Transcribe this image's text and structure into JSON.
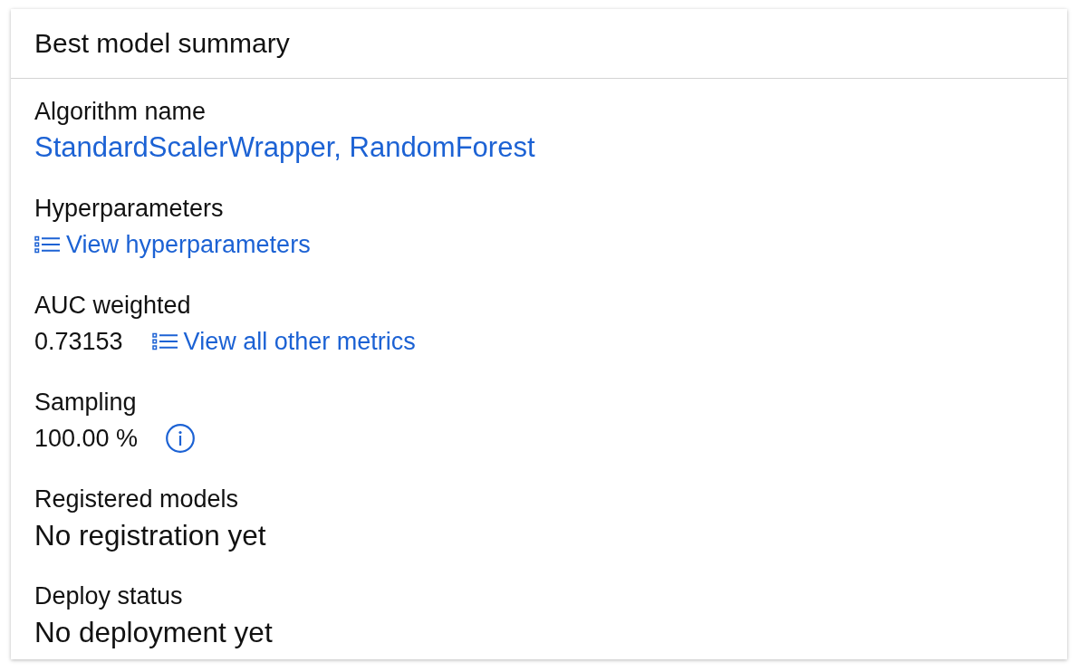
{
  "card": {
    "title": "Best model summary"
  },
  "fields": [
    {
      "kind": "link",
      "label": "Algorithm name",
      "link": "StandardScalerWrapper, RandomForest"
    },
    {
      "kind": "list_link",
      "label": "Hyperparameters",
      "link": "View hyperparameters"
    },
    {
      "kind": "value_list_link",
      "label": "AUC weighted",
      "value": "0.73153",
      "link": "View all other metrics"
    },
    {
      "kind": "value_info",
      "label": "Sampling",
      "value": "100.00 %"
    },
    {
      "kind": "text",
      "label": "Registered models",
      "value": "No registration yet"
    },
    {
      "kind": "text",
      "label": "Deploy status",
      "value": "No deployment yet"
    }
  ]
}
